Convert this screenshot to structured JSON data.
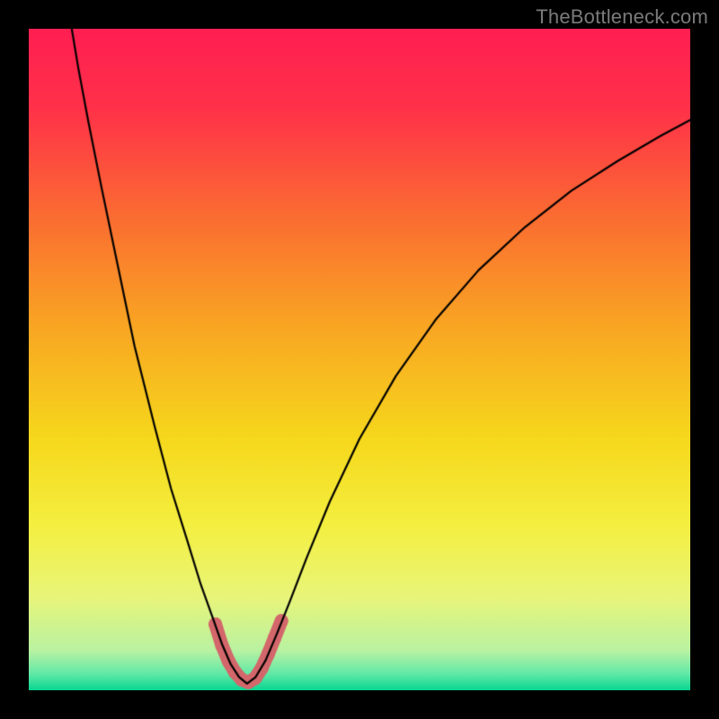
{
  "watermark": "TheBottleneck.com",
  "chart_data": {
    "type": "line",
    "title": "",
    "xlabel": "",
    "ylabel": "",
    "xlim": [
      0,
      1
    ],
    "ylim": [
      0,
      1
    ],
    "gradient_stops": [
      {
        "pos": 0.0,
        "color": "#ff1f52"
      },
      {
        "pos": 0.12,
        "color": "#ff3149"
      },
      {
        "pos": 0.28,
        "color": "#fb6b32"
      },
      {
        "pos": 0.45,
        "color": "#f9a623"
      },
      {
        "pos": 0.62,
        "color": "#f6d81c"
      },
      {
        "pos": 0.75,
        "color": "#f4ef40"
      },
      {
        "pos": 0.86,
        "color": "#e8f57a"
      },
      {
        "pos": 0.94,
        "color": "#b9f2a2"
      },
      {
        "pos": 0.975,
        "color": "#62e9a7"
      },
      {
        "pos": 1.0,
        "color": "#08d690"
      }
    ],
    "series": [
      {
        "name": "curve",
        "stroke": "#000000",
        "stroke_width": 2.2,
        "points": [
          {
            "x": 0.065,
            "y": 1.0
          },
          {
            "x": 0.075,
            "y": 0.94
          },
          {
            "x": 0.09,
            "y": 0.86
          },
          {
            "x": 0.11,
            "y": 0.76
          },
          {
            "x": 0.135,
            "y": 0.64
          },
          {
            "x": 0.16,
            "y": 0.52
          },
          {
            "x": 0.19,
            "y": 0.4
          },
          {
            "x": 0.215,
            "y": 0.305
          },
          {
            "x": 0.24,
            "y": 0.225
          },
          {
            "x": 0.26,
            "y": 0.16
          },
          {
            "x": 0.278,
            "y": 0.11
          },
          {
            "x": 0.292,
            "y": 0.07
          },
          {
            "x": 0.305,
            "y": 0.04
          },
          {
            "x": 0.318,
            "y": 0.02
          },
          {
            "x": 0.33,
            "y": 0.01
          },
          {
            "x": 0.343,
            "y": 0.02
          },
          {
            "x": 0.358,
            "y": 0.045
          },
          {
            "x": 0.375,
            "y": 0.085
          },
          {
            "x": 0.395,
            "y": 0.135
          },
          {
            "x": 0.42,
            "y": 0.2
          },
          {
            "x": 0.455,
            "y": 0.285
          },
          {
            "x": 0.5,
            "y": 0.38
          },
          {
            "x": 0.555,
            "y": 0.475
          },
          {
            "x": 0.615,
            "y": 0.56
          },
          {
            "x": 0.68,
            "y": 0.635
          },
          {
            "x": 0.75,
            "y": 0.7
          },
          {
            "x": 0.82,
            "y": 0.755
          },
          {
            "x": 0.89,
            "y": 0.8
          },
          {
            "x": 0.955,
            "y": 0.838
          },
          {
            "x": 1.0,
            "y": 0.862
          }
        ]
      },
      {
        "name": "markers",
        "stroke": "#d3676b",
        "stroke_width": 15,
        "linecap": "round",
        "points": [
          {
            "x": 0.282,
            "y": 0.1
          },
          {
            "x": 0.292,
            "y": 0.068
          },
          {
            "x": 0.302,
            "y": 0.044
          },
          {
            "x": 0.312,
            "y": 0.027
          },
          {
            "x": 0.322,
            "y": 0.016
          },
          {
            "x": 0.332,
            "y": 0.012
          },
          {
            "x": 0.342,
            "y": 0.018
          },
          {
            "x": 0.352,
            "y": 0.033
          },
          {
            "x": 0.362,
            "y": 0.055
          },
          {
            "x": 0.372,
            "y": 0.08
          },
          {
            "x": 0.382,
            "y": 0.105
          }
        ]
      }
    ]
  }
}
